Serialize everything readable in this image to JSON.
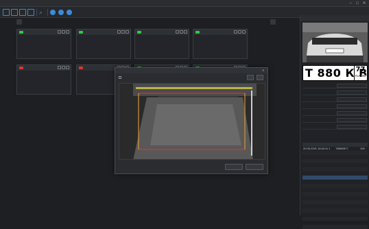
{
  "app": {
    "title": ""
  },
  "window_controls": {
    "minimize_icon": "minimize-icon",
    "maximize_icon": "maximize-icon",
    "close_icon": "close-icon",
    "close_glyph": "✕"
  },
  "toolbar": {
    "icons": [
      "layout-1x1-icon",
      "layout-2x2-icon",
      "layout-3x3-icon",
      "layout-4x4-icon",
      "search-icon",
      "camera-settings-icon",
      "network-icon",
      "info-icon"
    ],
    "accent": "#3d8bd6"
  },
  "tabs": {
    "left": "",
    "right": ""
  },
  "cards": [
    {
      "led": "#2ecc40",
      "rows": [
        {
          "k": "",
          "v": ""
        },
        {
          "k": "",
          "v": ""
        },
        {
          "k": "",
          "v": ""
        },
        {
          "k": "",
          "v": ""
        },
        {
          "k": "",
          "v": ""
        }
      ]
    },
    {
      "led": "#2ecc40",
      "rows": [
        {
          "k": "",
          "v": ""
        },
        {
          "k": "",
          "v": ""
        },
        {
          "k": "",
          "v": ""
        },
        {
          "k": "",
          "v": ""
        },
        {
          "k": "",
          "v": ""
        }
      ]
    },
    {
      "led": "#2ecc40",
      "rows": [
        {
          "k": "",
          "v": ""
        },
        {
          "k": "",
          "v": ""
        },
        {
          "k": "",
          "v": ""
        },
        {
          "k": "",
          "v": ""
        },
        {
          "k": "",
          "v": ""
        }
      ]
    },
    {
      "led": "#2ecc40",
      "rows": [
        {
          "k": "",
          "v": ""
        },
        {
          "k": "",
          "v": ""
        },
        {
          "k": "",
          "v": ""
        },
        {
          "k": "",
          "v": ""
        },
        {
          "k": "",
          "v": ""
        }
      ]
    },
    {
      "led": "#e0342c",
      "rows": [
        {
          "k": "",
          "v": ""
        },
        {
          "k": "",
          "v": ""
        },
        {
          "k": "",
          "v": ""
        },
        {
          "k": "",
          "v": ""
        },
        {
          "k": "",
          "v": ""
        }
      ]
    },
    {
      "led": "#e0342c",
      "rows": [
        {
          "k": "",
          "v": ""
        },
        {
          "k": "",
          "v": ""
        },
        {
          "k": "",
          "v": ""
        },
        {
          "k": "",
          "v": ""
        },
        {
          "k": "",
          "v": ""
        }
      ]
    },
    {
      "led": "#2ecc40",
      "rows": [
        {
          "k": "",
          "v": ""
        },
        {
          "k": "",
          "v": ""
        },
        {
          "k": "",
          "v": ""
        },
        {
          "k": "",
          "v": ""
        },
        {
          "k": "",
          "v": ""
        }
      ]
    },
    {
      "led": "#2ecc40",
      "rows": [
        {
          "k": "",
          "v": ""
        },
        {
          "k": "",
          "v": ""
        },
        {
          "k": "",
          "v": ""
        },
        {
          "k": "",
          "v": ""
        },
        {
          "k": "",
          "v": ""
        }
      ]
    }
  ],
  "modal": {
    "tab1": "",
    "tab2": "",
    "tab3": "",
    "option_label": "",
    "save_label": "",
    "cancel_label": "",
    "close_glyph": "✕"
  },
  "right_panel": {
    "title": "",
    "plate": {
      "number": "Т 880 К В",
      "region": "77",
      "country": "RUS"
    },
    "fields": [
      {
        "k": "",
        "v": ""
      },
      {
        "k": "",
        "v": ""
      },
      {
        "k": "",
        "v": ""
      },
      {
        "k": "",
        "v": ""
      },
      {
        "k": "",
        "v": ""
      },
      {
        "k": "",
        "v": ""
      },
      {
        "k": "",
        "v": ""
      }
    ],
    "log_title": "",
    "log_columns": [
      "",
      "",
      "",
      ""
    ],
    "log_rows": [
      [
        "20.06.2021 18:42:44",
        "1",
        "Т880КВ77",
        "100"
      ],
      [
        "",
        "",
        "",
        ""
      ],
      [
        "",
        "",
        "",
        ""
      ],
      [
        "",
        "",
        "",
        ""
      ],
      [
        "",
        "",
        "",
        ""
      ],
      [
        "",
        "",
        "",
        ""
      ],
      [
        "",
        "",
        "",
        ""
      ],
      [
        "",
        "",
        "",
        ""
      ],
      [
        "",
        "",
        "",
        ""
      ],
      [
        "",
        "",
        "",
        ""
      ],
      [
        "",
        "",
        "",
        ""
      ],
      [
        "",
        "",
        "",
        ""
      ],
      [
        "",
        "",
        "",
        ""
      ],
      [
        "",
        "",
        "",
        ""
      ],
      [
        "",
        "",
        "",
        ""
      ],
      [
        "",
        "",
        "",
        ""
      ],
      [
        "",
        "",
        "",
        ""
      ],
      [
        "",
        "",
        "",
        ""
      ],
      [
        "",
        "",
        "",
        ""
      ],
      [
        "",
        "",
        "",
        ""
      ]
    ]
  },
  "watermark": {
    "line1": "",
    "line2": ""
  }
}
